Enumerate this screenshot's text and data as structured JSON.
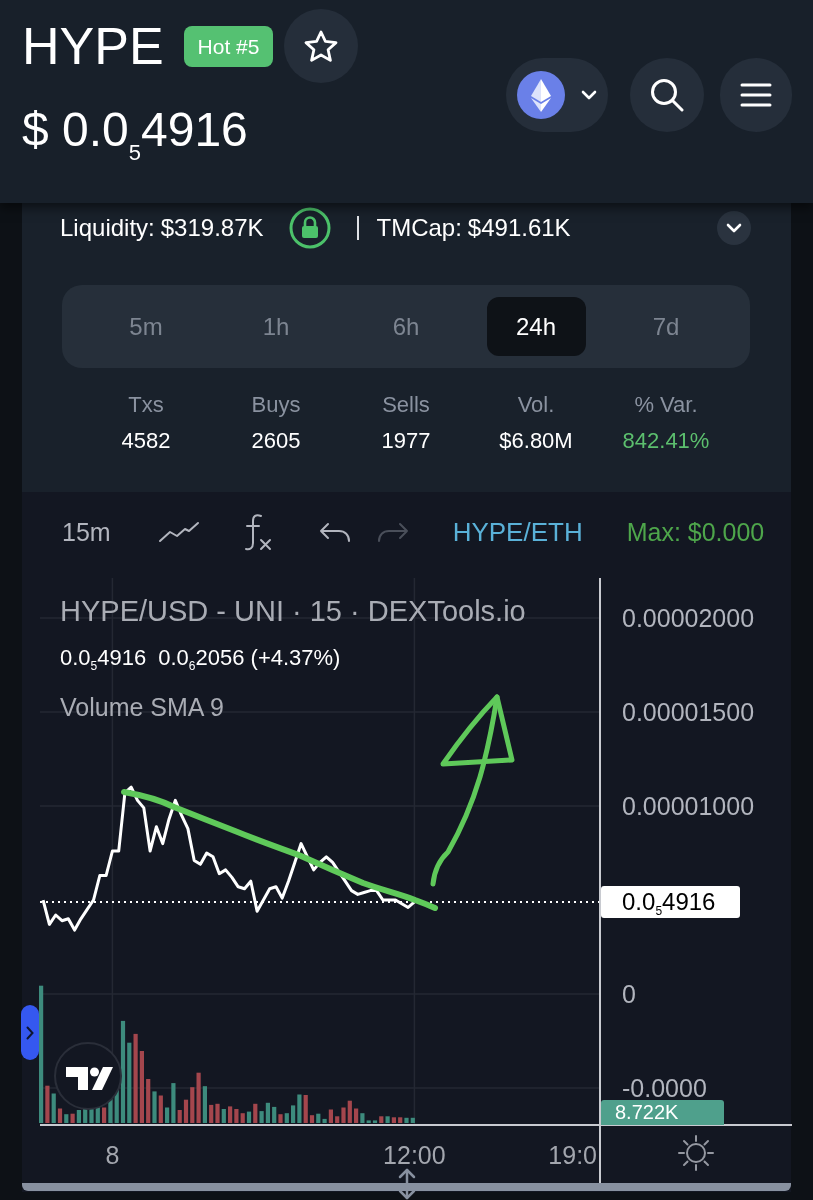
{
  "header": {
    "title": "HYPE",
    "badge": "Hot #5",
    "starred": false,
    "price": "$ 0.0$_{5}$4916"
  },
  "market": {
    "liquidity": {
      "label": "Liquidity:",
      "value": "$319.87K",
      "locked": true
    },
    "market_cap": {
      "label": "TMCap:",
      "value": "$491.61K"
    },
    "timeframes": [
      {
        "label": "5m",
        "selected": false
      },
      {
        "label": "1h",
        "selected": false
      },
      {
        "label": "6h",
        "selected": false
      },
      {
        "label": "24h",
        "selected": true
      },
      {
        "label": "7d",
        "selected": false
      }
    ],
    "stats": [
      {
        "label": "Txs",
        "value": "4582",
        "kind": "plain"
      },
      {
        "label": "Buys",
        "value": "2605",
        "kind": "plain"
      },
      {
        "label": "Sells",
        "value": "1977",
        "kind": "plain"
      },
      {
        "label": "Vol.",
        "value": "$6.80M",
        "kind": "plain"
      },
      {
        "label": "% Var.",
        "value": "842.41%",
        "kind": "gain"
      }
    ]
  },
  "chart": {
    "toolbar": {
      "interval": "15m",
      "tools": [
        {
          "kind": "chart_type",
          "disabled": false
        },
        {
          "kind": "indicators",
          "disabled": false
        },
        {
          "kind": "undo",
          "disabled": false
        },
        {
          "kind": "redo",
          "disabled": true
        }
      ],
      "pair": "HYPE/ETH",
      "max_price": "Max: $0.000"
    },
    "legend": {
      "title": "HYPE/USD - UNI · 15 · DEXTools.io",
      "price": "0.0$_{5}$4916",
      "change": "0.0$_{6}$2056 (+4.37%)",
      "indicator": "Volume SMA 9"
    },
    "volume_tag": "8.722K",
    "chart_data": {
      "type": "line",
      "grid": true,
      "categories": [
        null,
        null,
        null,
        null,
        null,
        null,
        null,
        null,
        null,
        null,
        null,
        "8",
        null,
        null,
        null,
        null,
        null,
        null,
        null,
        null,
        null,
        null,
        null,
        null,
        null,
        null,
        null,
        null,
        null,
        null,
        null,
        null,
        null,
        null,
        null,
        null,
        null,
        null,
        null,
        null,
        null,
        null,
        null,
        null,
        null,
        null,
        null,
        null,
        null,
        null,
        null,
        null,
        null,
        null,
        null,
        null,
        null,
        null,
        null,
        "12:00",
        null,
        null,
        null,
        null,
        null,
        null,
        null,
        null,
        null,
        null,
        null,
        null,
        null,
        null,
        null,
        null,
        null,
        null,
        null,
        null,
        null,
        null,
        null,
        null,
        null,
        null,
        null,
        "19:0",
        null
      ],
      "values": [
        5e-06,
        3.7e-06,
        4.2e-06,
        3.9e-06,
        4e-06,
        3.4e-06,
        4e-06,
        4.5e-06,
        5e-06,
        6.3e-06,
        6.3e-06,
        7.6e-06,
        7.6e-06,
        1.07e-05,
        1.1e-05,
        1.03e-05,
        9.9e-06,
        7.6e-06,
        8.9e-06,
        8e-06,
        9.3e-06,
        1.03e-05,
        9.5e-06,
        8.8e-06,
        7.1e-06,
        6.9e-06,
        7.5e-06,
        7.3e-06,
        6.4e-06,
        6.6e-06,
        6.2e-06,
        5.7e-06,
        5.6e-06,
        6e-06,
        4.4e-06,
        5e-06,
        5.6e-06,
        5.7e-06,
        5.1e-06,
        6e-06,
        7e-06,
        8e-06,
        7.3e-06,
        6.6e-06,
        7e-06,
        7.3e-06,
        7e-06,
        6.5e-06,
        6e-06,
        5.5e-06,
        5.3e-06,
        5.4e-06,
        5.5e-06,
        5.5e-06,
        5e-06,
        5e-06,
        5e-06,
        4.8e-06,
        4.6e-06,
        4.9e-06,
        null,
        null,
        null,
        null,
        null,
        null,
        null,
        null,
        null,
        null,
        null,
        null,
        null,
        null,
        null,
        null,
        null,
        null,
        null,
        null,
        null,
        null,
        null,
        null,
        null,
        null,
        null,
        null,
        null
      ],
      "ylim": [
        -6.97e-06,
        2.213e-05
      ],
      "yticks": [
        {
          "value": -5e-06,
          "label": "-0.0000"
        },
        {
          "value": 0,
          "label": "0"
        },
        {
          "value": 1e-05,
          "label": "0.00001000"
        },
        {
          "value": 1.5e-05,
          "label": "0.00001500"
        },
        {
          "value": 2e-05,
          "label": "0.00002000"
        }
      ],
      "ref_lines": [
        {
          "axis": "y",
          "value": 4.9e-06,
          "label": "0.0$_{5}$4916"
        }
      ]
    }
  }
}
